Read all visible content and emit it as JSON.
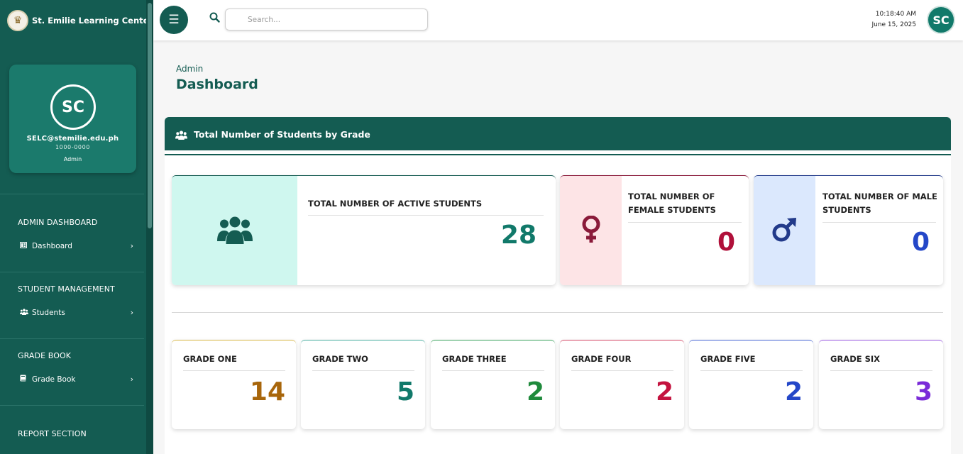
{
  "brand": {
    "name": "St. Emilie Learning Center",
    "logo_icon": "school-seal-icon"
  },
  "profile": {
    "initials": "SC",
    "email": "SELC@stemilie.edu.ph",
    "id": "1000-0000",
    "role": "Admin"
  },
  "sidebar": {
    "sections": [
      {
        "title": "ADMIN DASHBOARD",
        "item": {
          "label": "Dashboard",
          "icon": "dashboard-icon"
        }
      },
      {
        "title": "STUDENT MANAGEMENT",
        "item": {
          "label": "Students",
          "icon": "users-icon"
        }
      },
      {
        "title": "GRADE BOOK",
        "item": {
          "label": "Grade Book",
          "icon": "book-icon"
        }
      },
      {
        "title": "REPORT SECTION"
      }
    ]
  },
  "topbar": {
    "search_placeholder": "Search...",
    "time": "10:18:40 AM",
    "date": "June 15, 2025",
    "avatar_initials": "SC"
  },
  "page": {
    "breadcrumb": "Admin",
    "title": "Dashboard"
  },
  "panel": {
    "title": "Total Number of Students by Grade"
  },
  "stats": {
    "active": {
      "label": "TOTAL NUMBER OF ACTIVE STUDENTS",
      "value": "28",
      "color": "#11796a",
      "band": "#cff7ef"
    },
    "female": {
      "label": "TOTAL NUMBER OF FEMALE STUDENTS",
      "value": "0",
      "color": "#b0103a",
      "band": "#fde4e6"
    },
    "male": {
      "label": "TOTAL NUMBER OF MALE STUDENTS",
      "value": "0",
      "color": "#2447c8",
      "band": "#dbe8fd"
    }
  },
  "grades": [
    {
      "label": "GRADE ONE",
      "value": "14",
      "color": "#a8660b"
    },
    {
      "label": "GRADE TWO",
      "value": "5",
      "color": "#11796a"
    },
    {
      "label": "GRADE THREE",
      "value": "2",
      "color": "#1f8a3c"
    },
    {
      "label": "GRADE FOUR",
      "value": "2",
      "color": "#c4133f"
    },
    {
      "label": "GRADE FIVE",
      "value": "2",
      "color": "#2447c8"
    },
    {
      "label": "GRADE SIX",
      "value": "3",
      "color": "#7a2bd8"
    }
  ],
  "colors": {
    "primary": "#145c52",
    "accent": "#11796a"
  }
}
